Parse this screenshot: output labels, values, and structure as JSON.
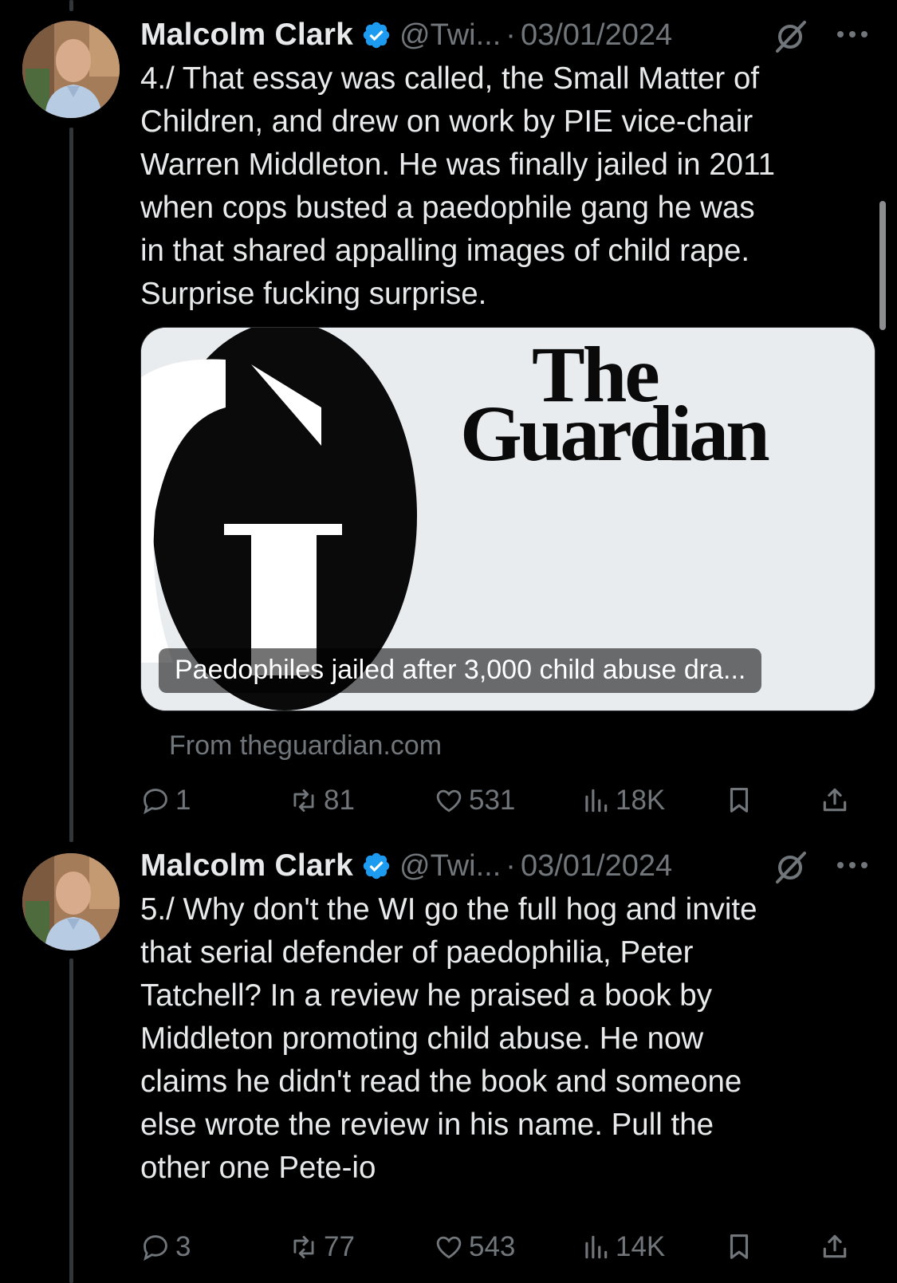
{
  "colors": {
    "background": "#000000",
    "text": "#e7e9ea",
    "muted": "#71767b",
    "verified": "#1d9bf0"
  },
  "tweets": [
    {
      "author_name": "Malcolm Clark",
      "handle": "@Twi...",
      "separator": "·",
      "date": "03/01/2024",
      "text": "4./ That essay was called, the Small Matter of\nChildren, and drew on work by PIE vice-chair\nWarren Middleton. He was finally jailed in 2011\nwhen cops busted a paedophile gang he was\nin that shared appalling images of child rape.\nSurprise fucking surprise.",
      "card": {
        "logo_line1": "The",
        "logo_line2": "Guardian",
        "headline": "Paedophiles jailed after 3,000 child abuse dra...",
        "source": "From theguardian.com"
      },
      "stats": {
        "replies": "1",
        "reposts": "81",
        "likes": "531",
        "views": "18K"
      }
    },
    {
      "author_name": "Malcolm Clark",
      "handle": "@Twi...",
      "separator": "·",
      "date": "03/01/2024",
      "text": "5./ Why don't the WI go the full hog and invite\nthat serial defender of paedophilia, Peter\nTatchell? In a review he praised a book by\nMiddleton promoting child abuse. He now\nclaims he didn't read the book and someone\nelse wrote the review in his name. Pull the\nother one Pete-io",
      "stats": {
        "replies": "3",
        "reposts": "77",
        "likes": "543",
        "views": "14K"
      }
    }
  ]
}
